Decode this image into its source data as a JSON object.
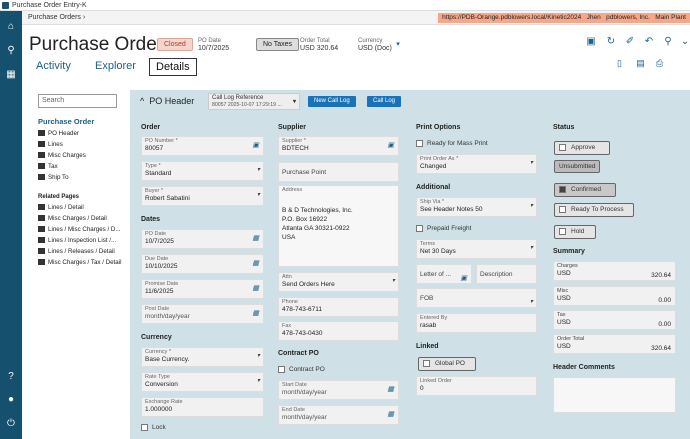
{
  "window": {
    "title": "Purchase Order Entry-K"
  },
  "breadcrumb": {
    "text": "Purchase Orders"
  },
  "env": {
    "url": "https://PDB-Orange.pdblowers.local/Kinetic2024",
    "user": "Jhen",
    "company": "pdblowers, Inc.",
    "plant": "Main Plant"
  },
  "header": {
    "title": "Purchase Orders",
    "status": "Closed",
    "po_date_label": "PO Date",
    "po_date": "10/7/2025",
    "no_taxes": "No Taxes",
    "order_total_label": "Order Total",
    "order_total": "USD 320.64",
    "currency_label": "Currency",
    "currency": "USD (Doc)"
  },
  "tabs": [
    {
      "label": "Activity"
    },
    {
      "label": "Explorer"
    },
    {
      "label": "Details"
    }
  ],
  "left_nav": {
    "search_placeholder": "Search",
    "section": "Purchase Order",
    "items": [
      "PO Header",
      "Lines",
      "Misc Charges",
      "Tax",
      "Ship To"
    ],
    "related_label": "Related Pages",
    "related": [
      "Lines / Detail",
      "Misc Charges / Detail",
      "Lines / Misc Charges / D...",
      "Lines / Inspection List /...",
      "Lines / Releases / Detail",
      "Misc Charges / Tax / Detail"
    ]
  },
  "panel": {
    "title": "PO Header",
    "call_log_label": "Call Log Reference",
    "call_log_value": "80057 2025-10-07 17:29:19 ...",
    "new_call_log": "New Call Log",
    "call_log": "Call Log"
  },
  "order": {
    "section": "Order",
    "po_number_label": "PO Number *",
    "po_number": "80057",
    "type_label": "Type *",
    "type": "Standard",
    "buyer_label": "Buyer *",
    "buyer": "Robert Sabatini"
  },
  "dates": {
    "section": "Dates",
    "po_date_label": "PO Date",
    "po_date": "10/7/2025",
    "due_date_label": "Due Date",
    "due_date": "10/10/2025",
    "promise_date_label": "Promise Date",
    "promise_date": "11/6/2025",
    "post_date_label": "Post Date",
    "post_date": "month/day/year"
  },
  "currency": {
    "section": "Currency",
    "currency_label": "Currency *",
    "currency": "Base Currency.",
    "rate_type_label": "Rate Type",
    "rate_type": "Conversion",
    "exchange_rate_label": "Exchange Rate",
    "exchange_rate": "1.000000",
    "lock": "Lock"
  },
  "supplier": {
    "section": "Supplier",
    "supplier_label": "Supplier *",
    "supplier": "BDTECH",
    "purchase_point": "Purchase Point",
    "address_label": "Address",
    "address": [
      "B & D Technologies, Inc.",
      "P.O. Box 16922",
      "Atlanta GA 30321-0922",
      "USA"
    ],
    "attn_label": "Attn",
    "attn": "Send Orders Here",
    "phone_label": "Phone",
    "phone": "478-743-6711",
    "fax_label": "Fax",
    "fax": "478-743-0430"
  },
  "contract": {
    "section": "Contract PO",
    "contract_po": "Contract PO",
    "start_label": "Start Date",
    "start": "month/day/year",
    "end_label": "End Date",
    "end": "month/day/year"
  },
  "print": {
    "section": "Print Options",
    "ready_mass": "Ready for Mass Print",
    "print_as_label": "Print Order As *",
    "print_as": "Changed"
  },
  "additional": {
    "section": "Additional",
    "ship_via_label": "Ship Via *",
    "ship_via": "See Header Notes 50",
    "prepaid": "Prepaid Freight",
    "terms_label": "Terms",
    "terms": "Net 30 Days",
    "letter": "Letter of ...",
    "description": "Description",
    "fob": "FOB",
    "entered_by_label": "Entered By",
    "entered_by": "rasab"
  },
  "linked": {
    "section": "Linked",
    "global_po": "Global PO",
    "linked_order_label": "Linked Order",
    "linked_order": "0"
  },
  "status": {
    "section": "Status",
    "approve": "Approve",
    "unsubmitted": "Unsubmitted",
    "confirmed": "Confirmed",
    "ready_process": "Ready To Process",
    "hold": "Hold"
  },
  "summary": {
    "section": "Summary",
    "charges_label": "Charges",
    "charges_cur": "USD",
    "charges": "320.64",
    "misc_label": "Misc",
    "misc_cur": "USD",
    "misc": "0.00",
    "tax_label": "Tax",
    "tax_cur": "USD",
    "tax": "0.00",
    "order_total_label": "Order Total",
    "order_total_cur": "USD",
    "order_total": "320.64"
  },
  "comments": {
    "section": "Header Comments"
  },
  "colors": {
    "rail": "#15506e",
    "accent": "#1f5f86",
    "panel": "#cfe1e6",
    "button": "#1a73b8",
    "env": "#f5a889"
  }
}
